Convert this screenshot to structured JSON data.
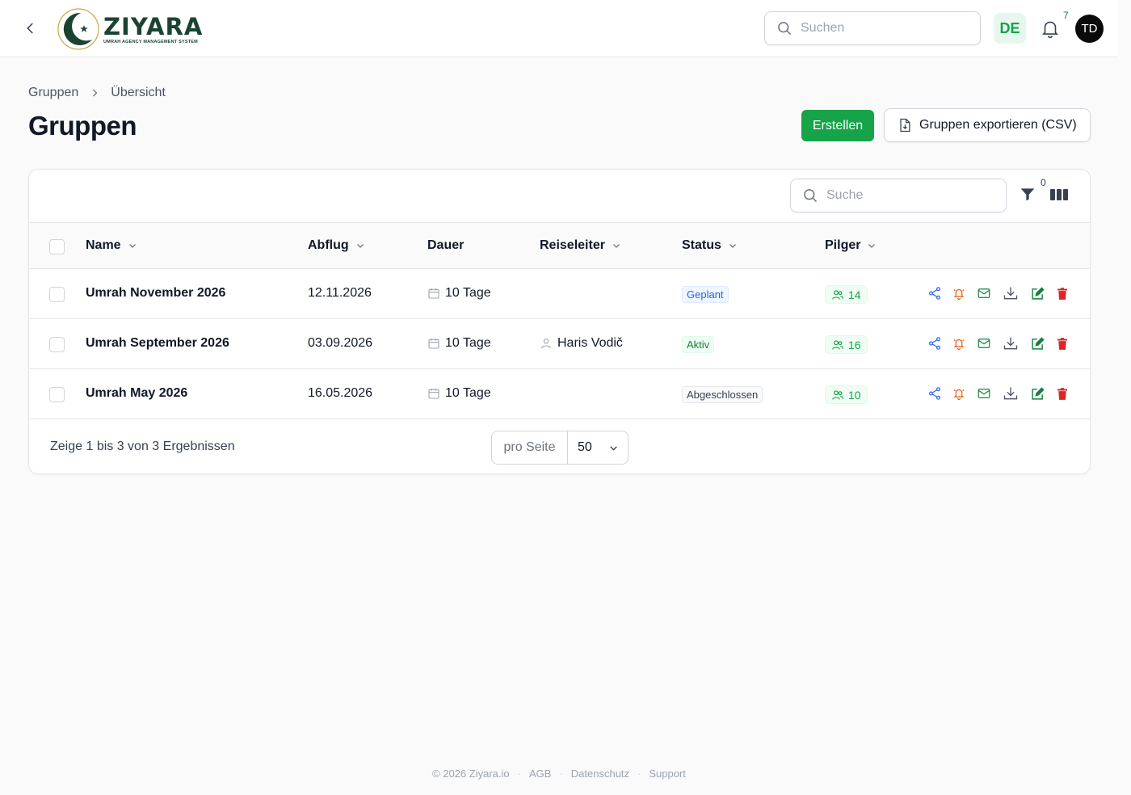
{
  "header": {
    "logo_title": "ZIYARA",
    "logo_subtitle": "UMRAH AGENCY MANAGEMENT SYSTEM",
    "search_placeholder": "Suchen",
    "language": "DE",
    "notification_count": "7",
    "avatar_initials": "TD"
  },
  "breadcrumb": {
    "items": [
      "Gruppen",
      "Übersicht"
    ]
  },
  "page": {
    "title": "Gruppen",
    "create_label": "Erstellen",
    "export_label": "Gruppen exportieren (CSV)"
  },
  "table": {
    "search_placeholder": "Suche",
    "filter_count": "0",
    "columns": {
      "name": "Name",
      "abflug": "Abflug",
      "dauer": "Dauer",
      "reiseleiter": "Reiseleiter",
      "status": "Status",
      "pilger": "Pilger"
    },
    "rows": [
      {
        "name": "Umrah November 2026",
        "abflug": "12.11.2026",
        "dauer": "10 Tage",
        "reiseleiter": "",
        "status": "Geplant",
        "pilger": "14"
      },
      {
        "name": "Umrah September 2026",
        "abflug": "03.09.2026",
        "dauer": "10 Tage",
        "reiseleiter": "Haris Vodič",
        "status": "Aktiv",
        "pilger": "16"
      },
      {
        "name": "Umrah May 2026",
        "abflug": "16.05.2026",
        "dauer": "10 Tage",
        "reiseleiter": "",
        "status": "Abgeschlossen",
        "pilger": "10"
      }
    ],
    "summary": "Zeige 1 bis 3 von 3 Ergebnissen",
    "per_page_label": "pro Seite",
    "per_page_value": "50"
  },
  "footer": {
    "copyright": "© 2026 Ziyara.io",
    "links": [
      "AGB",
      "Datenschutz",
      "Support"
    ]
  },
  "colors": {
    "brand_green": "#16a34a",
    "logo_green": "#1b4332",
    "status_planned": "#2563eb",
    "status_active": "#15803d",
    "action_share": "#2563eb",
    "action_notify": "#ea580c",
    "action_edit": "#15803d",
    "action_delete": "#dc2626"
  }
}
